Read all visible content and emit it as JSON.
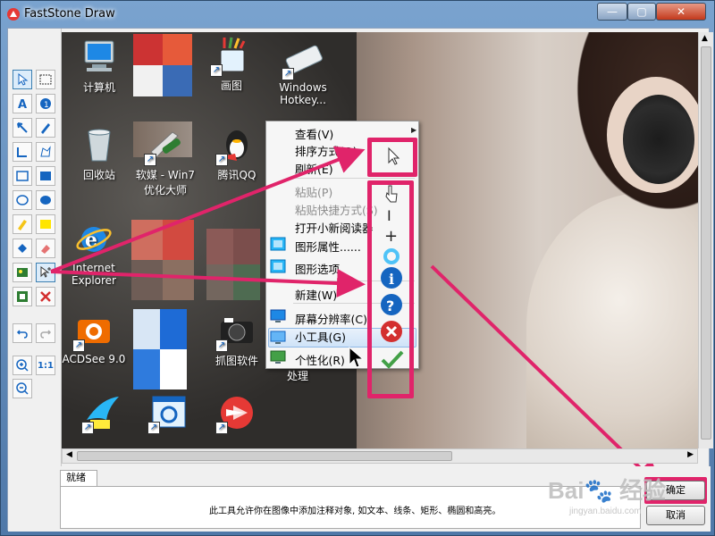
{
  "window": {
    "title": "FastStone Draw",
    "controls": {
      "minimize": "—",
      "maximize": "▢",
      "close": "✕"
    }
  },
  "desktop_icons": [
    {
      "label": "计算机"
    },
    {
      "label": ""
    },
    {
      "label": "画图"
    },
    {
      "label": "Windows Hotkey..."
    },
    {
      "label": "回收站"
    },
    {
      "label": "软媒 - Win7 优化大师"
    },
    {
      "label": "腾讯QQ"
    },
    {
      "label": "Internet Explorer"
    },
    {
      "label": "ACDSee 9.0"
    },
    {
      "label": "抓图软件"
    },
    {
      "label": "处理"
    }
  ],
  "context_menu": {
    "items": [
      {
        "label": "查看(V)",
        "submenu": true
      },
      {
        "label": "排序方式(O)"
      },
      {
        "label": "刷新(E)"
      },
      {
        "label": "粘贴(P)",
        "disabled": true
      },
      {
        "label": "粘贴快捷方式(S)",
        "disabled": true
      },
      {
        "label": "打开小新阅读器"
      },
      {
        "label": "图形属性......"
      },
      {
        "label": "图形选项"
      },
      {
        "label": "新建(W)"
      },
      {
        "label": "屏幕分辨率(C)"
      },
      {
        "label": "小工具(G)"
      },
      {
        "label": "个性化(R)"
      }
    ]
  },
  "status": {
    "tab_label": "就绪",
    "description": "此工具允许你在图像中添加注释对象, 如文本、线条、矩形、椭圆和高亮。"
  },
  "buttons": {
    "ok": "确定",
    "cancel": "取消"
  },
  "zoom_label": "1:1",
  "watermark": {
    "main": "Bai🐾 经验",
    "sub": "jingyan.baidu.com"
  },
  "colors": {
    "highlight": "#e0246a",
    "accent": "#3c7fb1"
  }
}
